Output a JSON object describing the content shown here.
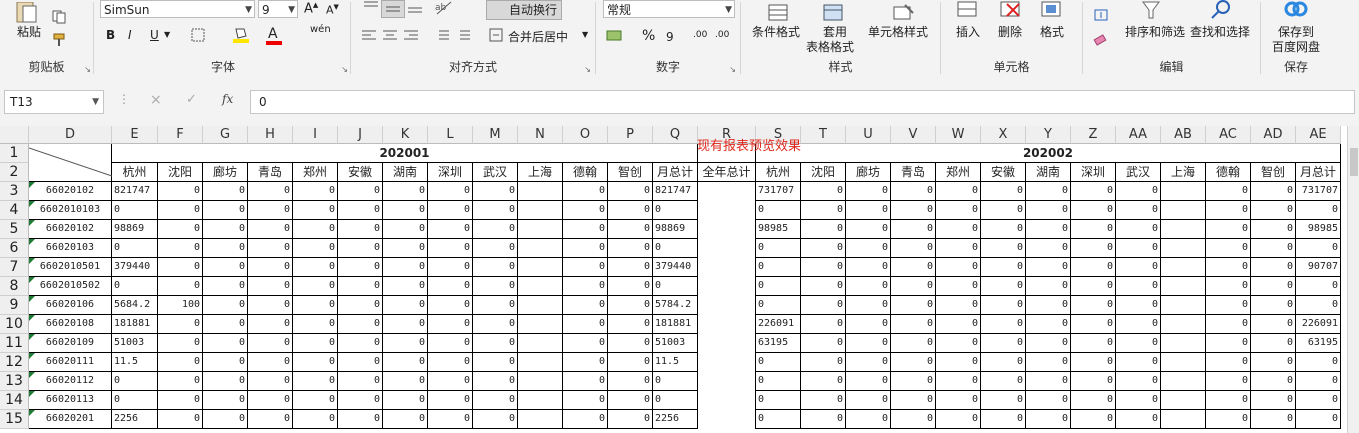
{
  "ribbon": {
    "clipboard": {
      "paste": "粘贴",
      "group": "剪贴板"
    },
    "font": {
      "name": "SimSun",
      "size": "9",
      "bold": "B",
      "italic": "I",
      "underline": "U",
      "group": "字体",
      "grow": "A",
      "shrink": "A",
      "fontcolor_letter": "A",
      "wen": "wén"
    },
    "alignment": {
      "wrap": "自动换行",
      "merge": "合并后居中",
      "group": "对齐方式"
    },
    "number": {
      "format": "常规",
      "percent": "%",
      "comma": "9",
      "inc": ".00",
      "dec": ".00",
      "group": "数字"
    },
    "styles": {
      "conditional": "条件格式",
      "table1": "套用",
      "table2": "表格格式",
      "cellstyle": "单元格样式",
      "group": "样式"
    },
    "cells": {
      "insert": "插入",
      "delete": "删除",
      "format": "格式",
      "group": "单元格"
    },
    "editing": {
      "sortfilter": "排序和筛选",
      "findselect": "查找和选择",
      "group": "编辑"
    },
    "save": {
      "line1": "保存到",
      "line2": "百度网盘",
      "group": "保存"
    }
  },
  "formula_bar": {
    "name_box": "T13",
    "value": "0",
    "cancel": "×",
    "enter": "✓",
    "fx": "fx"
  },
  "columns": [
    "D",
    "E",
    "F",
    "G",
    "H",
    "I",
    "J",
    "K",
    "L",
    "M",
    "N",
    "O",
    "P",
    "Q",
    "R",
    "S",
    "T",
    "U",
    "V",
    "W",
    "X",
    "Y",
    "Z",
    "AA",
    "AB",
    "AC",
    "AD",
    "AE"
  ],
  "rows": [
    "1",
    "2",
    "3",
    "4",
    "5",
    "6",
    "7",
    "8",
    "9",
    "10",
    "11",
    "12",
    "13",
    "14",
    "15"
  ],
  "period1": "202001",
  "period2": "202002",
  "annual_total": "全年总计",
  "cities": [
    "杭州",
    "沈阳",
    "廊坊",
    "青岛",
    "郑州",
    "安徽",
    "湖南",
    "深圳",
    "武汉",
    "上海",
    "德翰",
    "智创",
    "月总计"
  ],
  "accounts": [
    "66020102",
    "6602010103",
    "66020102",
    "66020103",
    "6602010501",
    "6602010502",
    "66020106",
    "66020108",
    "66020109",
    "66020111",
    "66020112",
    "66020113",
    "66020201"
  ],
  "data1": [
    [
      "821747",
      "0",
      "0",
      "0",
      "0",
      "0",
      "0",
      "0",
      "0",
      "",
      "0",
      "0",
      "821747"
    ],
    [
      "0",
      "0",
      "0",
      "0",
      "0",
      "0",
      "0",
      "0",
      "0",
      "",
      "0",
      "0",
      "0"
    ],
    [
      "98869",
      "0",
      "0",
      "0",
      "0",
      "0",
      "0",
      "0",
      "0",
      "",
      "0",
      "0",
      "98869"
    ],
    [
      "0",
      "0",
      "0",
      "0",
      "0",
      "0",
      "0",
      "0",
      "0",
      "",
      "0",
      "0",
      "0"
    ],
    [
      "379440",
      "0",
      "0",
      "0",
      "0",
      "0",
      "0",
      "0",
      "0",
      "",
      "0",
      "0",
      "379440"
    ],
    [
      "0",
      "0",
      "0",
      "0",
      "0",
      "0",
      "0",
      "0",
      "0",
      "",
      "0",
      "0",
      "0"
    ],
    [
      "5684.2",
      "100",
      "0",
      "0",
      "0",
      "0",
      "0",
      "0",
      "0",
      "",
      "0",
      "0",
      "5784.2"
    ],
    [
      "181881",
      "0",
      "0",
      "0",
      "0",
      "0",
      "0",
      "0",
      "0",
      "",
      "0",
      "0",
      "181881"
    ],
    [
      "51003",
      "0",
      "0",
      "0",
      "0",
      "0",
      "0",
      "0",
      "0",
      "",
      "0",
      "0",
      "51003"
    ],
    [
      "11.5",
      "0",
      "0",
      "0",
      "0",
      "0",
      "0",
      "0",
      "0",
      "",
      "0",
      "0",
      "11.5"
    ],
    [
      "0",
      "0",
      "0",
      "0",
      "0",
      "0",
      "0",
      "0",
      "0",
      "",
      "0",
      "0",
      "0"
    ],
    [
      "0",
      "0",
      "0",
      "0",
      "0",
      "0",
      "0",
      "0",
      "0",
      "",
      "0",
      "0",
      "0"
    ],
    [
      "2256",
      "0",
      "0",
      "0",
      "0",
      "0",
      "0",
      "0",
      "0",
      "",
      "0",
      "0",
      "2256"
    ]
  ],
  "data2": [
    [
      "731707",
      "0",
      "0",
      "0",
      "0",
      "0",
      "0",
      "0",
      "0",
      "",
      "0",
      "0",
      "731707"
    ],
    [
      "0",
      "0",
      "0",
      "0",
      "0",
      "0",
      "0",
      "0",
      "0",
      "",
      "0",
      "0",
      "0"
    ],
    [
      "98985",
      "0",
      "0",
      "0",
      "0",
      "0",
      "0",
      "0",
      "0",
      "",
      "0",
      "0",
      "98985"
    ],
    [
      "0",
      "0",
      "0",
      "0",
      "0",
      "0",
      "0",
      "0",
      "0",
      "",
      "0",
      "0",
      "0"
    ],
    [
      "0",
      "0",
      "0",
      "0",
      "0",
      "0",
      "0",
      "0",
      "0",
      "",
      "0",
      "0",
      "90707"
    ],
    [
      "0",
      "0",
      "0",
      "0",
      "0",
      "0",
      "0",
      "0",
      "0",
      "",
      "0",
      "0",
      "0"
    ],
    [
      "0",
      "0",
      "0",
      "0",
      "0",
      "0",
      "0",
      "0",
      "0",
      "",
      "0",
      "0",
      "0"
    ],
    [
      "226091",
      "0",
      "0",
      "0",
      "0",
      "0",
      "0",
      "0",
      "0",
      "",
      "0",
      "0",
      "226091"
    ],
    [
      "63195",
      "0",
      "0",
      "0",
      "0",
      "0",
      "0",
      "0",
      "0",
      "",
      "0",
      "0",
      "63195"
    ],
    [
      "0",
      "0",
      "0",
      "0",
      "0",
      "0",
      "0",
      "0",
      "0",
      "",
      "0",
      "0",
      "0"
    ],
    [
      "0",
      "0",
      "0",
      "0",
      "0",
      "0",
      "0",
      "0",
      "0",
      "",
      "0",
      "0",
      "0"
    ],
    [
      "0",
      "0",
      "0",
      "0",
      "0",
      "0",
      "0",
      "0",
      "0",
      "",
      "0",
      "0",
      "0"
    ],
    [
      "0",
      "0",
      "0",
      "0",
      "0",
      "0",
      "0",
      "0",
      "0",
      "",
      "0",
      "0",
      "0"
    ]
  ],
  "overlay_note": "现有报表预览效果"
}
